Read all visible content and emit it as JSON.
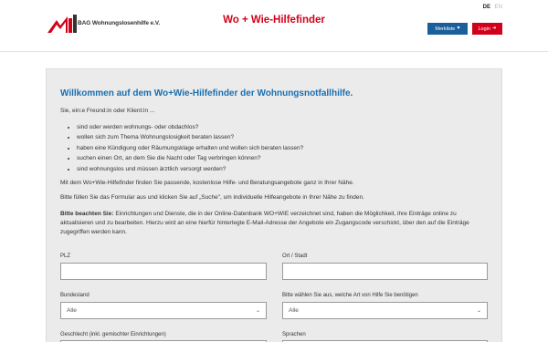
{
  "header": {
    "logo_text": "BAG Wohnungslosenhilfe e.V.",
    "site_title": "Wo + Wie-Hilfefinder",
    "lang_active": "DE",
    "lang_inactive": "EN",
    "merkliste_label": "Merkliste",
    "merkliste_icon": "heart-icon",
    "login_label": "Login",
    "login_icon": "sign-in-icon",
    "brand_red": "#d0021b",
    "brand_blue": "#1a5e9b"
  },
  "main": {
    "title": "Willkommen auf dem Wo+Wie-Hilfefinder der Wohnungsnotfallhilfe.",
    "intro": "Sie, ein:e Freund:in oder Klient:in ...",
    "items": [
      "sind oder werden wohnungs- oder obdachlos?",
      "wollen sich zum Thema Wohnungslosigkeit beraten lassen?",
      "haben eine Kündigung oder Räumungsklage erhalten und wollen sich beraten lassen?",
      "suchen einen Ort, an dem Sie die Nacht oder Tag verbringen können?",
      "sind wohnungslos und müssen ärztlich versorgt werden?"
    ],
    "para1": "Mit dem Wo+Wie-Hilfefinder finden Sie passende, kostenlose Hilfe- und Beratungsangebote ganz in Ihrer Nähe.",
    "para2": "Bitte füllen Sie das Formular aus und klicken Sie auf „Suche\", um individuelle Hilfeangebote in Ihrer Nähe zu finden.",
    "note_label": "Bitte beachten Sie:",
    "note_text": " Einrichtungen und Dienste, die in der Online-Datenbank WO+WIE verzeichnet sind, haben die Möglichkeit, ihre Einträge online zu aktualisieren und zu bearbeiten. Hierzu wird an eine hierfür hinterlegte E-Mail-Adresse der Angebote ein Zugangscode verschickt, über den auf die Einträge zugegriffen werden kann."
  },
  "form": {
    "plz_label": "PLZ",
    "plz_value": "",
    "ort_label": "Ort / Stadt",
    "ort_value": "",
    "bundesland_label": "Bundesland",
    "bundesland_value": "Alle",
    "hilfe_label": "Bitte wählen Sie aus, welche Art von Hilfe Sie benötigen",
    "hilfe_value": "Alle",
    "geschlecht_label": "Geschlecht (inkl. gemischter Einrichtungen)",
    "sprachen_label": "Sprachen"
  }
}
